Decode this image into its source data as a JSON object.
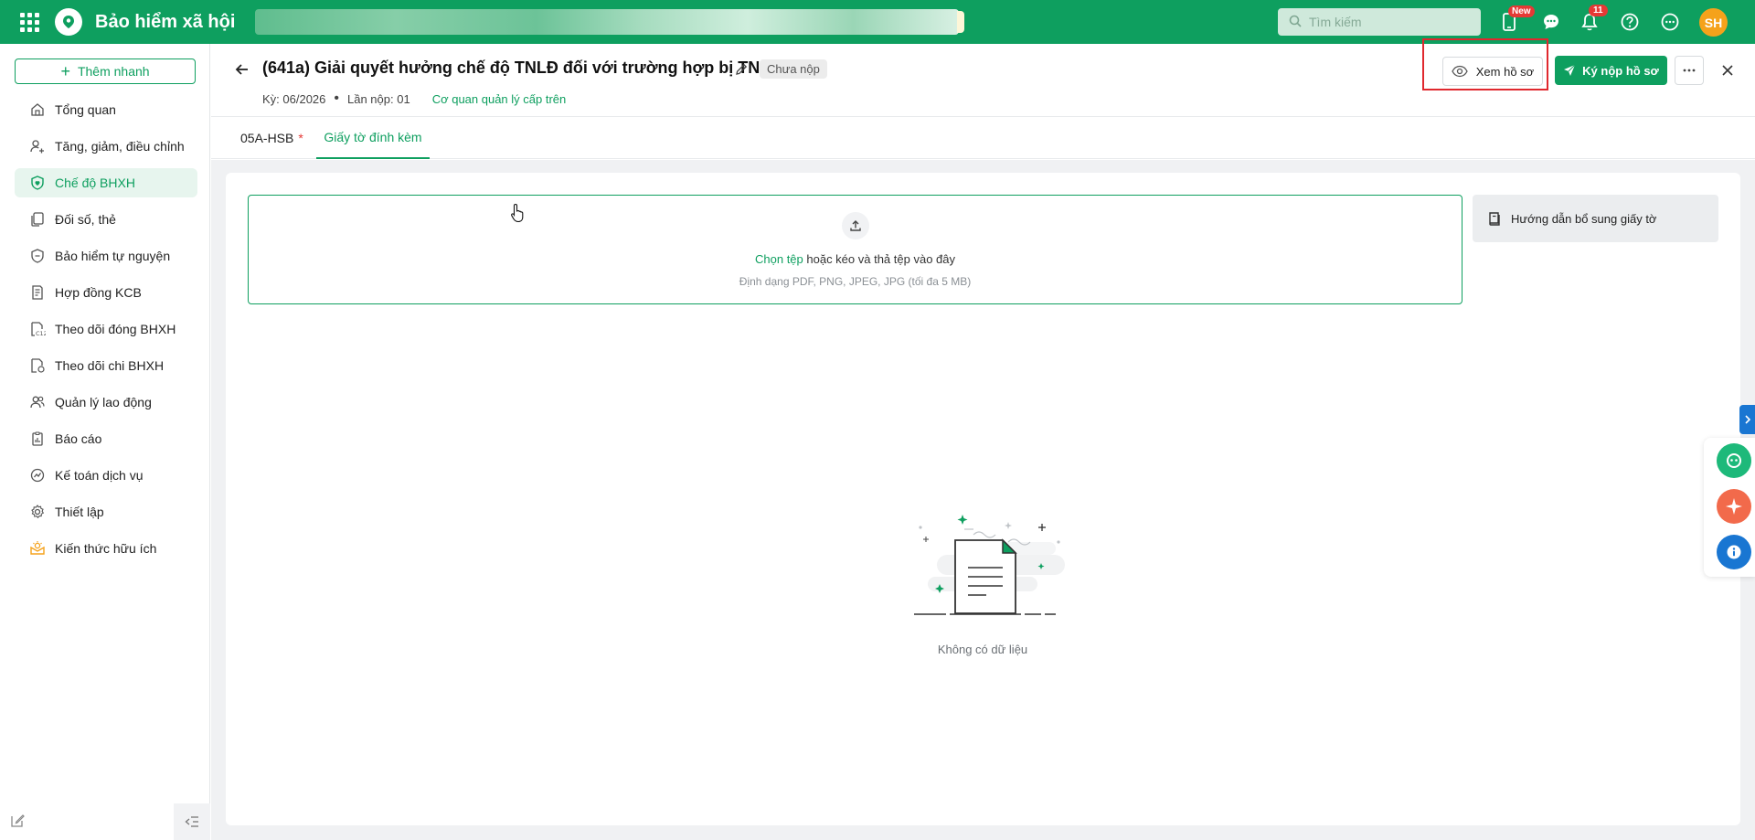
{
  "topbar": {
    "brand": "Bảo hiểm xã hội",
    "search_placeholder": "Tìm kiếm",
    "new_badge": "New",
    "notification_count": "11",
    "avatar_initials": "SH",
    "brand_color": "#0e9f5f"
  },
  "sidebar": {
    "quick_add": "Thêm nhanh",
    "items": [
      {
        "label": "Tổng quan",
        "icon": "home-icon"
      },
      {
        "label": "Tăng, giảm, điều chỉnh",
        "icon": "user-adjust-icon"
      },
      {
        "label": "Chế độ BHXH",
        "icon": "shield-heart-icon",
        "active": true
      },
      {
        "label": "Đối số, thẻ",
        "icon": "cards-icon"
      },
      {
        "label": "Bảo hiểm tự nguyện",
        "icon": "shield-icon"
      },
      {
        "label": "Hợp đồng KCB",
        "icon": "contract-icon"
      },
      {
        "label": "Theo dõi đóng BHXH",
        "icon": "c12-doc-icon"
      },
      {
        "label": "Theo dõi chi BHXH",
        "icon": "payout-doc-icon"
      },
      {
        "label": "Quản lý lao động",
        "icon": "users-icon"
      },
      {
        "label": "Báo cáo",
        "icon": "report-icon"
      },
      {
        "label": "Kế toán dịch vụ",
        "icon": "accounting-icon"
      },
      {
        "label": "Thiết lập",
        "icon": "gear-icon"
      },
      {
        "label": "Kiến thức hữu ích",
        "icon": "knowledge-icon"
      }
    ]
  },
  "header": {
    "title": "(641a) Giải quyết hưởng chế độ TNLĐ đối với trường hợp bị TN...",
    "status": "Chưa nộp",
    "period": "Kỳ: 06/2026",
    "submit_count": "Lần nộp: 01",
    "agency_link": "Cơ quan quản lý cấp trên",
    "view_button": "Xem hồ sơ",
    "sign_button": "Ký nộp hồ sơ"
  },
  "tabs": [
    {
      "label": "05A-HSB",
      "required_mark": "*"
    },
    {
      "label": "Giấy tờ đính kèm",
      "active": true
    }
  ],
  "dropzone": {
    "choose_link": "Chọn tệp",
    "instruction": " hoặc kéo và thả tệp vào đây",
    "formats": "Định dạng PDF, PNG, JPEG, JPG (tối đa 5 MB)"
  },
  "guide_button": "Hướng dẫn bổ sung giấy tờ",
  "empty_state": "Không có dữ liệu"
}
